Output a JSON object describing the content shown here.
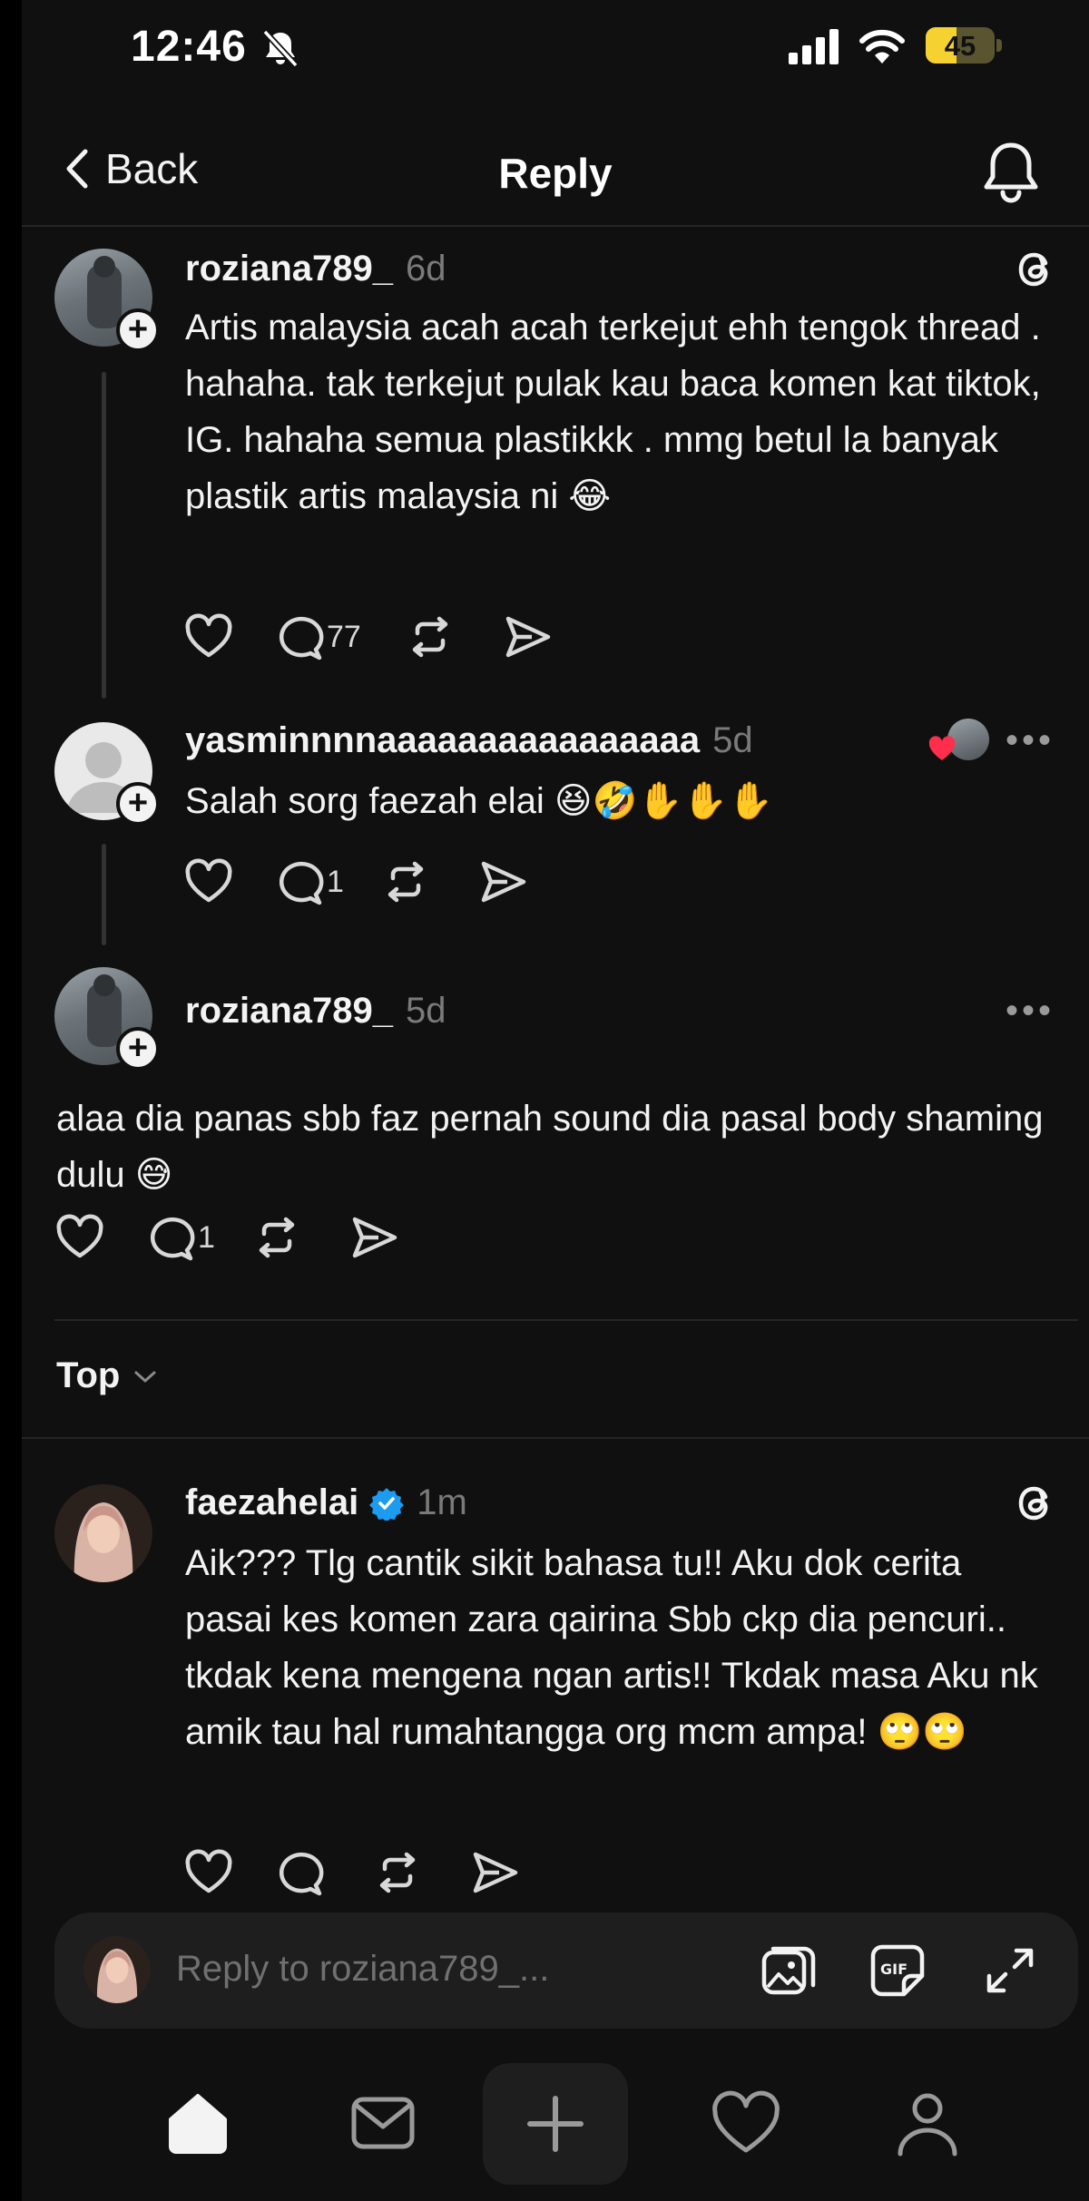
{
  "status_bar": {
    "time": "12:46",
    "battery": "45",
    "battery_level": 0.45
  },
  "nav": {
    "back_label": "Back",
    "title": "Reply"
  },
  "posts": [
    {
      "username": "roziana789_",
      "time": "6d",
      "text": "Artis malaysia acah acah terkejut ehh tengok thread . hahaha. tak terkejut pulak kau baca komen kat tiktok, IG. hahaha semua plastikkk . mmg betul la banyak plastik artis malaysia ni 😂",
      "reply_count": "77"
    },
    {
      "username": "yasminnnnaaaaaaaaaaaaaaaa",
      "time": "5d",
      "text": "Salah sorg faezah elai 😆🤣✋✋✋",
      "reply_count": "1"
    },
    {
      "username": "roziana789_",
      "time": "5d",
      "text": "alaa dia panas sbb faz pernah sound dia pasal body shaming dulu 😅",
      "reply_count": "1"
    }
  ],
  "sort": {
    "label": "Top"
  },
  "reply": {
    "username": "faezahelai",
    "time": "1m",
    "text": "Aik??? Tlg cantik sikit bahasa tu!! Aku dok cerita pasai kes komen zara qairina Sbb ckp dia pencuri.. tkdak kena mengena ngan artis!! Tkdak masa Aku nk amik tau hal rumahtangga org mcm ampa! 🙄🙄"
  },
  "composer": {
    "placeholder": "Reply to roziana789_..."
  },
  "icons": {
    "status": [
      "bell-slash-icon",
      "signal-icon",
      "wifi-icon",
      "battery-icon"
    ],
    "nav": [
      "chevron-left-icon",
      "bell-icon"
    ],
    "post_actions": [
      "heart-icon",
      "comment-icon",
      "repost-icon",
      "share-icon"
    ],
    "composer": [
      "image-icon",
      "gif-icon",
      "expand-icon"
    ],
    "tabs": [
      "home-icon",
      "inbox-icon",
      "plus-icon",
      "heart-icon",
      "profile-icon"
    ]
  }
}
